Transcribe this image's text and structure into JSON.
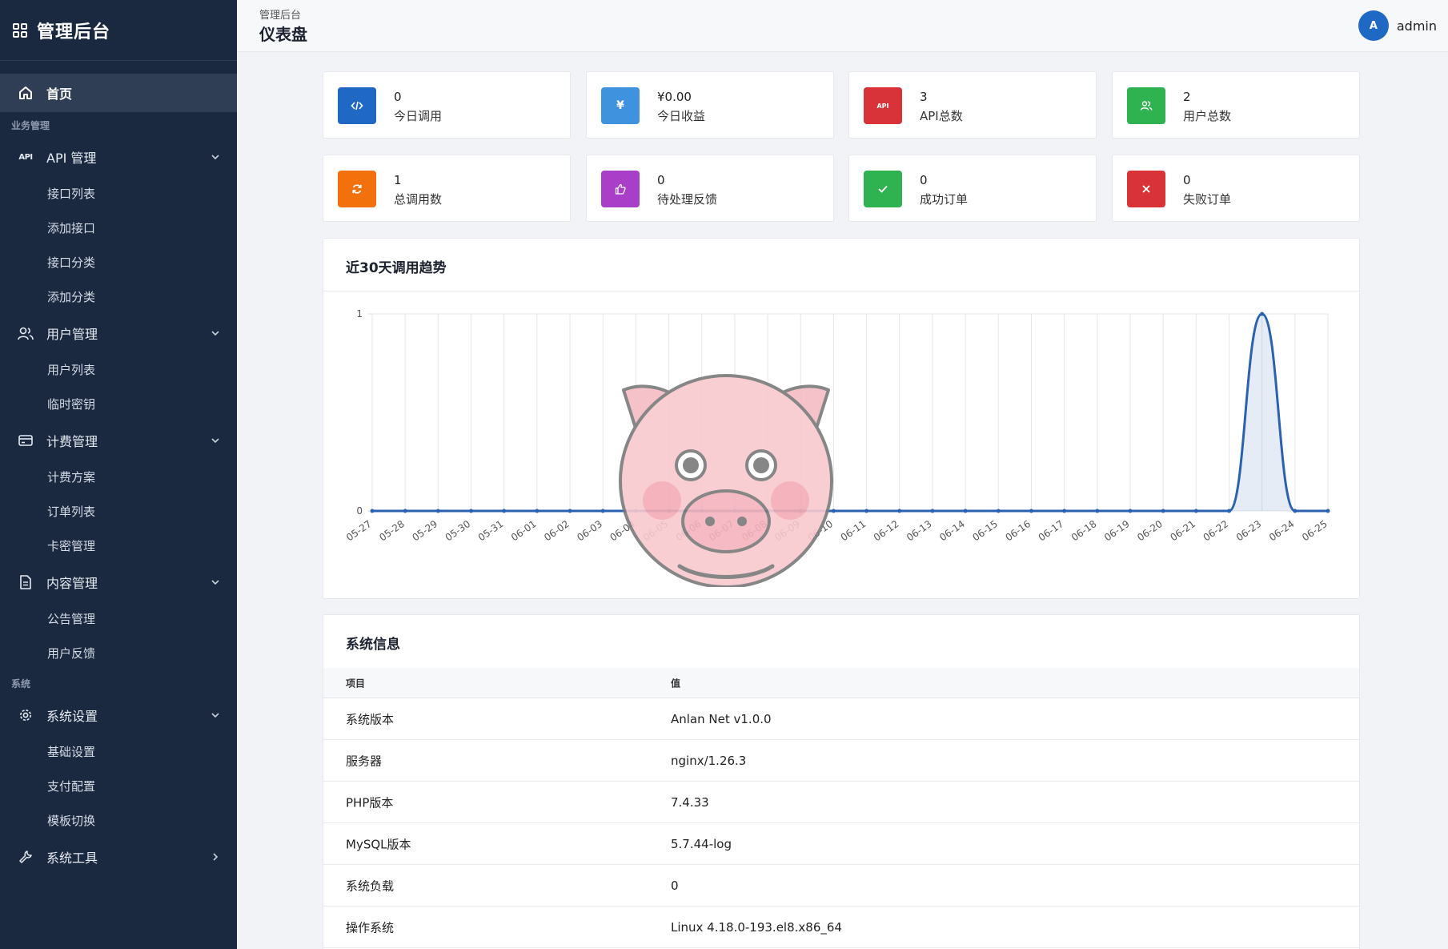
{
  "sidebar": {
    "brand": "管理后台",
    "home": "首页",
    "sections": {
      "business": "业务管理",
      "system": "系统"
    },
    "groups": {
      "api": {
        "label": "API 管理",
        "items": [
          "接口列表",
          "添加接口",
          "接口分类",
          "添加分类"
        ]
      },
      "users": {
        "label": "用户管理",
        "items": [
          "用户列表",
          "临时密钥"
        ]
      },
      "billing": {
        "label": "计费管理",
        "items": [
          "计费方案",
          "订单列表",
          "卡密管理"
        ]
      },
      "content": {
        "label": "内容管理",
        "items": [
          "公告管理",
          "用户反馈"
        ]
      },
      "settings": {
        "label": "系统设置",
        "items": [
          "基础设置",
          "支付配置",
          "模板切换"
        ]
      },
      "tools": {
        "label": "系统工具"
      }
    },
    "api_icon_text": "API"
  },
  "header": {
    "breadcrumb": "管理后台",
    "title": "仪表盘",
    "avatar_letter": "A",
    "username": "admin"
  },
  "stats": [
    {
      "value": "0",
      "label": "今日调用",
      "color": "#1f68c4",
      "icon": "code-icon"
    },
    {
      "value": "¥0.00",
      "label": "今日收益",
      "color": "#3f92de",
      "icon": "yen-icon"
    },
    {
      "value": "3",
      "label": "API总数",
      "color": "#d9333a",
      "icon": "api-icon"
    },
    {
      "value": "2",
      "label": "用户总数",
      "color": "#2fb350",
      "icon": "users-icon"
    },
    {
      "value": "1",
      "label": "总调用数",
      "color": "#f2710c",
      "icon": "refresh-icon"
    },
    {
      "value": "0",
      "label": "待处理反馈",
      "color": "#a93fc9",
      "icon": "thumbs-up-icon"
    },
    {
      "value": "0",
      "label": "成功订单",
      "color": "#2fb350",
      "icon": "check-icon"
    },
    {
      "value": "0",
      "label": "失败订单",
      "color": "#d9333a",
      "icon": "x-icon"
    }
  ],
  "chart_card": {
    "title": "近30天调用趋势"
  },
  "chart_data": {
    "type": "line",
    "x": [
      "05-27",
      "05-28",
      "05-29",
      "05-30",
      "05-31",
      "06-01",
      "06-02",
      "06-03",
      "06-04",
      "06-05",
      "06-06",
      "06-07",
      "06-08",
      "06-09",
      "06-10",
      "06-11",
      "06-12",
      "06-13",
      "06-14",
      "06-15",
      "06-16",
      "06-17",
      "06-18",
      "06-19",
      "06-20",
      "06-21",
      "06-22",
      "06-23",
      "06-24",
      "06-25"
    ],
    "series": [
      {
        "values": [
          0,
          0,
          0,
          0,
          0,
          0,
          0,
          0,
          0,
          0,
          0,
          0,
          0,
          0,
          0,
          0,
          0,
          0,
          0,
          0,
          0,
          0,
          0,
          0,
          0,
          0,
          0,
          1,
          0,
          0
        ],
        "color": "#2a62b0"
      }
    ],
    "ylim": [
      0,
      1
    ],
    "yticks": [
      "0",
      "1"
    ],
    "grid": true,
    "fill": true
  },
  "sysinfo": {
    "title": "系统信息",
    "columns": [
      "项目",
      "值"
    ],
    "rows": [
      [
        "系统版本",
        "Anlan Net v1.0.0"
      ],
      [
        "服务器",
        "nginx/1.26.3"
      ],
      [
        "PHP版本",
        "7.4.33"
      ],
      [
        "MySQL版本",
        "5.7.44-log"
      ],
      [
        "系统负载",
        "0"
      ],
      [
        "操作系统",
        "Linux 4.18.0-193.el8.x86_64"
      ]
    ]
  }
}
